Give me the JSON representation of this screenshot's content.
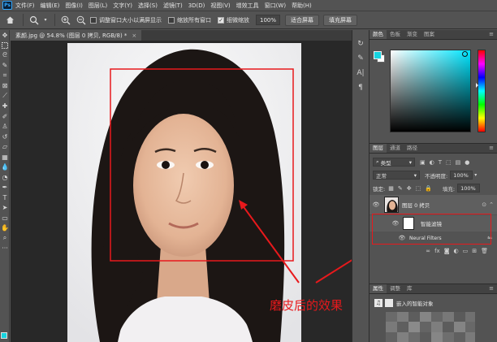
{
  "menu": {
    "logo": "Ps",
    "items": [
      "文件(F)",
      "编辑(E)",
      "图像(I)",
      "图层(L)",
      "文字(Y)",
      "选择(S)",
      "滤镜(T)",
      "3D(D)",
      "视图(V)",
      "增效工具",
      "窗口(W)",
      "帮助(H)"
    ]
  },
  "options": {
    "check1": "调整窗口大小以满屏显示",
    "check2": "缩放所有窗口",
    "check3": "细微缩放",
    "zoom_value": "100%",
    "fit_screen": "适合屏幕",
    "fill_screen": "填充屏幕"
  },
  "document": {
    "tab_title": "素颜.jpg @ 54.8% (图层 0 拷贝, RGB/8) *",
    "close": "×"
  },
  "annotation": {
    "caption": "磨皮后的效果",
    "color": "#e8191c"
  },
  "color_panel": {
    "tabs": [
      "颜色",
      "色板",
      "渐变",
      "图案"
    ],
    "fg_color": "#17d4e0",
    "bg_color": "#ffffff"
  },
  "layers_panel": {
    "tabs": [
      "图层",
      "通道",
      "路径"
    ],
    "filter_kind": "类型",
    "blend_mode": "正常",
    "opacity_label": "不透明度:",
    "opacity_value": "100%",
    "lock_label": "锁定:",
    "fill_label": "填充:",
    "fill_value": "100%",
    "layers": [
      {
        "name": "图层 0 拷贝"
      },
      {
        "name": "智能滤镜"
      },
      {
        "name": "Neural Filters"
      }
    ]
  },
  "properties_panel": {
    "tabs": [
      "属性",
      "调整",
      "库"
    ],
    "object_type": "嵌入的智能对象"
  }
}
